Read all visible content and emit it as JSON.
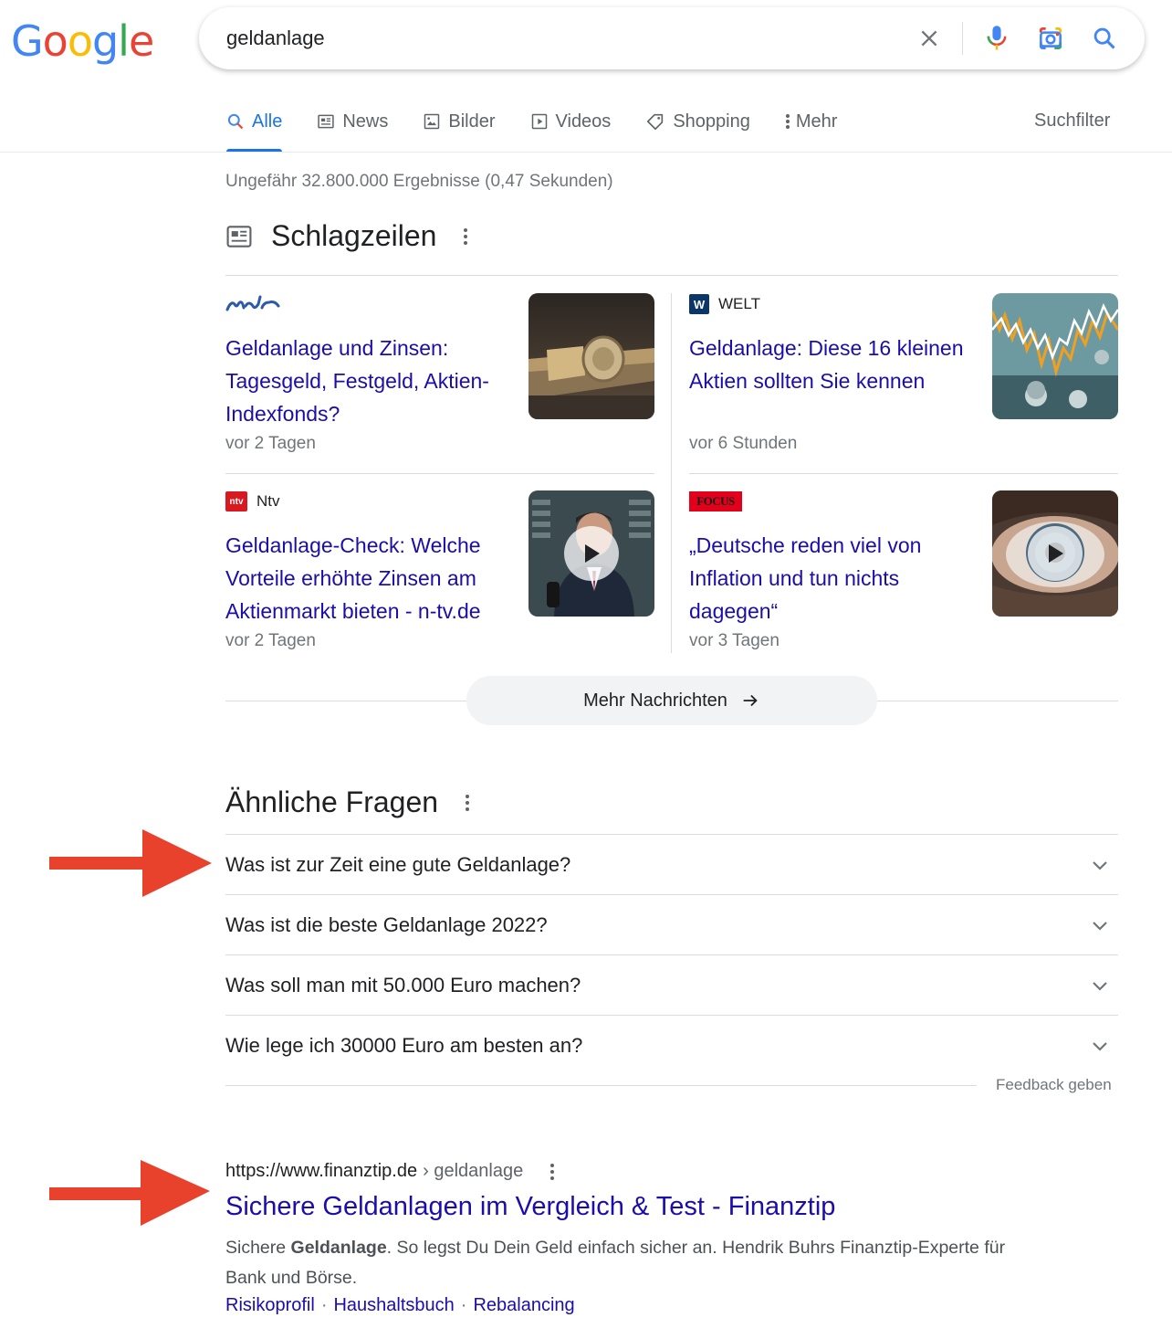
{
  "logo": {
    "text": "Google"
  },
  "search": {
    "query": "geldanlage"
  },
  "tabs": [
    {
      "label": "Alle",
      "icon": "search-icon"
    },
    {
      "label": "News",
      "icon": "news-icon"
    },
    {
      "label": "Bilder",
      "icon": "image-icon"
    },
    {
      "label": "Videos",
      "icon": "video-icon"
    },
    {
      "label": "Shopping",
      "icon": "tag-icon"
    },
    {
      "label": "Mehr",
      "icon": "more-vert-icon"
    }
  ],
  "suchfilter": "Suchfilter",
  "result_stats": "Ungefähr 32.800.000 Ergebnisse (0,47 Sekunden)",
  "headlines": {
    "title": "Schlagzeilen",
    "cards": [
      {
        "source": "mdr",
        "title": "Geldanlage und Zinsen: Tagesgeld, Festgeld, Aktien-Indexfonds?",
        "time": "vor 2 Tagen"
      },
      {
        "source": "WELT",
        "title": "Geldanlage: Diese 16 kleinen Aktien sollten Sie kennen",
        "time": "vor 6 Stunden"
      },
      {
        "source": "Ntv",
        "title": "Geldanlage-Check: Welche Vorteile erhöhte Zinsen am Aktienmarkt bieten - n-tv.de",
        "time": "vor 2 Tagen"
      },
      {
        "source": "FOCUS online",
        "title": "„Deutsche reden viel von Inflation und tun nichts dagegen“",
        "time": "vor 3 Tagen"
      }
    ],
    "more_button": "Mehr Nachrichten"
  },
  "paa": {
    "title": "Ähnliche Fragen",
    "questions": [
      "Was ist zur Zeit eine gute Geldanlage?",
      "Was ist die beste Geldanlage 2022?",
      "Was soll man mit 50.000 Euro machen?",
      "Wie lege ich 30000 Euro am besten an?"
    ],
    "feedback": "Feedback geben"
  },
  "result": {
    "url": "https://www.finanztip.de",
    "crumb": "› geldanlage",
    "title": "Sichere Geldanlagen im Vergleich & Test - Finanztip",
    "snippet_pre": "Sichere ",
    "snippet_bold": "Geldanlage",
    "snippet_post": ". So legst Du Dein Geld einfach sicher an. Hendrik Buhrs Finanztip-Experte für Bank und Börse.",
    "sitelinks": [
      "Risikoprofil",
      "Haushaltsbuch",
      "Rebalancing"
    ]
  },
  "colors": {
    "link": "#1a0dab",
    "accent": "#1a73e8",
    "arrow": "#e8412c"
  }
}
